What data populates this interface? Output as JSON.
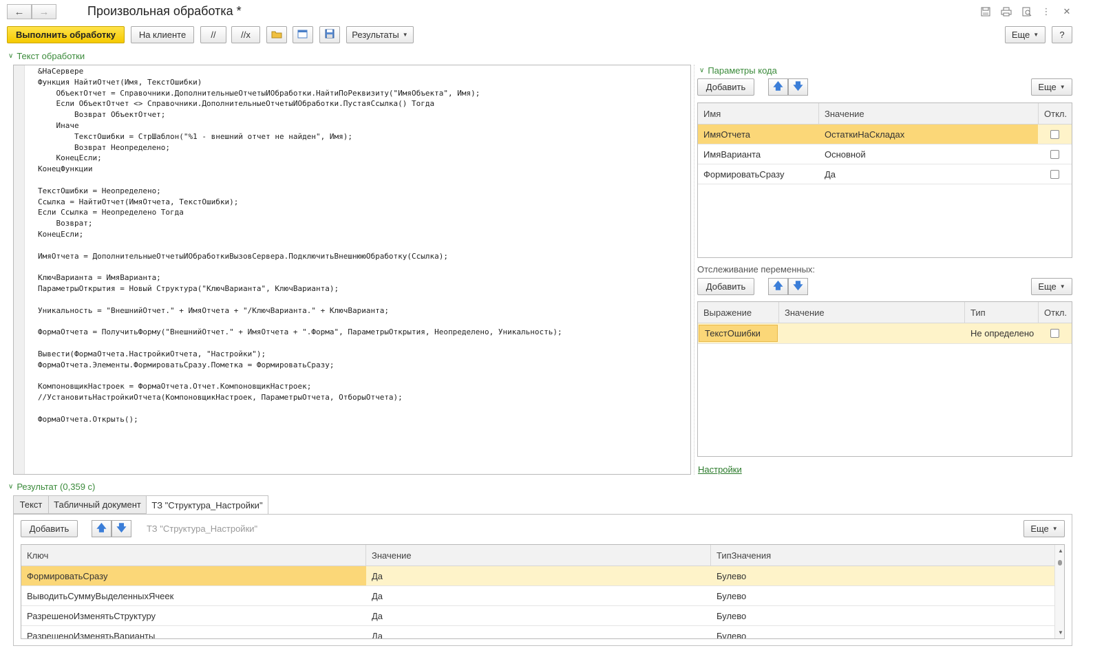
{
  "window": {
    "title": "Произвольная обработка *",
    "back_label": "←",
    "forward_label": "→"
  },
  "toolbar": {
    "run_label": "Выполнить обработку",
    "client_label": "На клиенте",
    "comment_label": "//",
    "uncomment_label": "//x",
    "results_label": "Результаты",
    "more_label": "Еще",
    "help_label": "?"
  },
  "code_section": {
    "label": "Текст обработки",
    "lines": [
      "&НаСервере",
      "Функция НайтиОтчет(Имя, ТекстОшибки)",
      "    ОбъектОтчет = Справочники.ДополнительныеОтчетыИОбработки.НайтиПоРеквизиту(\"ИмяОбъекта\", Имя);",
      "    Если ОбъектОтчет <> Справочники.ДополнительныеОтчетыИОбработки.ПустаяСсылка() Тогда",
      "        Возврат ОбъектОтчет;",
      "    Иначе",
      "        ТекстОшибки = СтрШаблон(\"%1 - внешний отчет не найден\", Имя);",
      "        Возврат Неопределено;",
      "    КонецЕсли;",
      "КонецФункции",
      "",
      "ТекстОшибки = Неопределено;",
      "Ссылка = НайтиОтчет(ИмяОтчета, ТекстОшибки);",
      "Если Ссылка = Неопределено Тогда",
      "    Возврат;",
      "КонецЕсли;",
      "",
      "ИмяОтчета = ДополнительныеОтчетыИОбработкиВызовСервера.ПодключитьВнешнююОбработку(Ссылка);",
      "",
      "КлючВарианта = ИмяВарианта;",
      "ПараметрыОткрытия = Новый Структура(\"КлючВарианта\", КлючВарианта);",
      "",
      "Уникальность = \"ВнешнийОтчет.\" + ИмяОтчета + \"/КлючВарианта.\" + КлючВарианта;",
      "",
      "ФормаОтчета = ПолучитьФорму(\"ВнешнийОтчет.\" + ИмяОтчета + \".Форма\", ПараметрыОткрытия, Неопределено, Уникальность);",
      "",
      "Вывести(ФормаОтчета.НастройкиОтчета, \"Настройки\");",
      "ФормаОтчета.Элементы.ФормироватьСразу.Пометка = ФормироватьСразу;",
      "",
      "КомпоновщикНастроек = ФормаОтчета.Отчет.КомпоновщикНастроек;",
      "//УстановитьНастройкиОтчета(КомпоновщикНастроек, ПараметрыОтчета, ОтборыОтчета);",
      "",
      "ФормаОтчета.Открыть();"
    ]
  },
  "params": {
    "label": "Параметры кода",
    "add_label": "Добавить",
    "more_label": "Еще",
    "columns": [
      "Имя",
      "Значение",
      "Откл."
    ],
    "rows": [
      {
        "name": "ИмяОтчета",
        "value": "ОстаткиНаСкладах"
      },
      {
        "name": "ИмяВарианта",
        "value": "Основной"
      },
      {
        "name": "ФормироватьСразу",
        "value": "Да"
      }
    ]
  },
  "watch": {
    "label": "Отслеживание переменных:",
    "add_label": "Добавить",
    "more_label": "Еще",
    "columns": [
      "Выражение",
      "Значение",
      "Тип",
      "Откл."
    ],
    "rows": [
      {
        "expr": "ТекстОшибки",
        "value": "",
        "type": "Не определено"
      }
    ]
  },
  "settings_link": "Настройки",
  "result": {
    "label": "Результат (0,359 с)",
    "tabs": [
      "Текст",
      "Табличный документ",
      "ТЗ \"Структура_Настройки\""
    ],
    "add_label": "Добавить",
    "table_caption": "ТЗ \"Структура_Настройки\"",
    "more_label": "Еще",
    "columns": [
      "Ключ",
      "Значение",
      "ТипЗначения"
    ],
    "rows": [
      {
        "key": "ФормироватьСразу",
        "value": "Да",
        "type": "Булево"
      },
      {
        "key": "ВыводитьСуммуВыделенныхЯчеек",
        "value": "Да",
        "type": "Булево"
      },
      {
        "key": "РазрешеноИзменятьСтруктуру",
        "value": "Да",
        "type": "Булево"
      },
      {
        "key": "РазрешеноИзменятьВарианты",
        "value": "Да",
        "type": "Булево"
      }
    ]
  }
}
